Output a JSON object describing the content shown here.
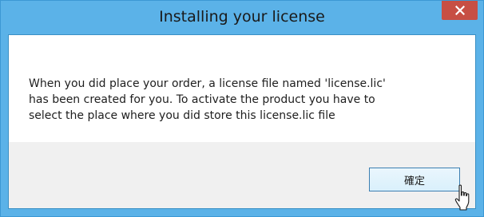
{
  "window": {
    "title": "Installing your license",
    "close_icon": "close-icon"
  },
  "message": {
    "text": "When you did place your order, a license file named 'license.lic'\nhas been created for you. To activate the product you have to\nselect the place where you did store this license.lic file"
  },
  "buttons": {
    "ok_label": "確定"
  },
  "cursor": {
    "icon": "hand-pointer-icon"
  },
  "colors": {
    "titlebar": "#5bb2e8",
    "close_button": "#c74f44",
    "footer": "#f0f0f0",
    "button_border": "#3c7fb1"
  }
}
